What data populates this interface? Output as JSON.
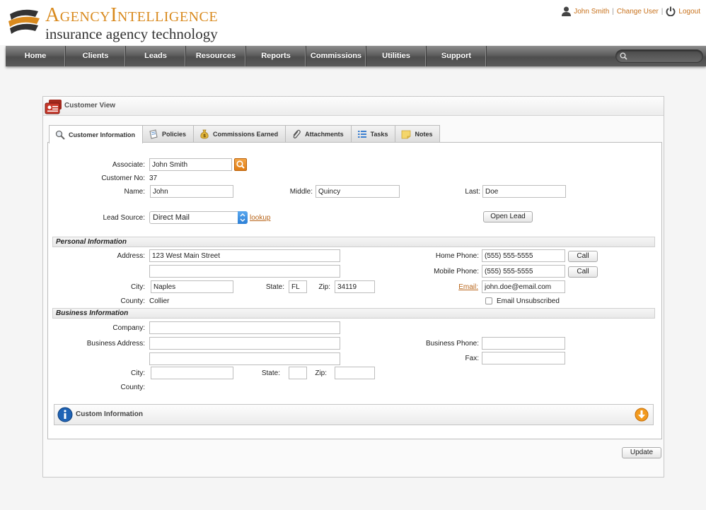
{
  "brand": {
    "title": "AgencyIntelligence",
    "subtitle": "insurance agency technology"
  },
  "userbar": {
    "user": "John Smith",
    "change_user": "Change User",
    "logout": "Logout",
    "separator": "|"
  },
  "nav": {
    "items": [
      "Home",
      "Clients",
      "Leads",
      "Resources",
      "Reports",
      "Commissions",
      "Utilities",
      "Support"
    ],
    "search_placeholder": ""
  },
  "panel": {
    "title": "Customer View",
    "tabs": [
      "Customer Information",
      "Policies",
      "Commissions Earned",
      "Attachments",
      "Tasks",
      "Notes"
    ]
  },
  "form": {
    "associate_label": "Associate:",
    "associate_value": "John Smith",
    "customer_no_label": "Customer No:",
    "customer_no_value": "37",
    "name_label": "Name:",
    "name_value": "John",
    "middle_label": "Middle:",
    "middle_value": "Quincy",
    "last_label": "Last:",
    "last_value": "Doe",
    "lead_source_label": "Lead Source:",
    "lead_source_value": "Direct Mail",
    "lookup_link": "lookup",
    "open_lead_button": "Open Lead"
  },
  "personal": {
    "section_title": "Personal Information",
    "address_label": "Address:",
    "address1": "123 West Main Street",
    "address2": "",
    "city_label": "City:",
    "city_value": "Naples",
    "state_label": "State:",
    "state_value": "FL",
    "zip_label": "Zip:",
    "zip_value": "34119",
    "county_label": "County:",
    "county_value": "Collier",
    "home_phone_label": "Home Phone:",
    "home_phone_value": "(555) 555-5555",
    "mobile_phone_label": "Mobile Phone:",
    "mobile_phone_value": "(555) 555-5555",
    "call_button": "Call",
    "email_label": "Email:",
    "email_value": "john.doe@email.com",
    "unsubscribed_label": "Email Unsubscribed"
  },
  "business": {
    "section_title": "Business Information",
    "company_label": "Company:",
    "company_value": "",
    "address_label": "Business Address:",
    "address1": "",
    "address2": "",
    "city_label": "City:",
    "city_value": "",
    "state_label": "State:",
    "state_value": "",
    "zip_label": "Zip:",
    "zip_value": "",
    "county_label": "County:",
    "phone_label": "Business Phone:",
    "phone_value": "",
    "fax_label": "Fax:",
    "fax_value": ""
  },
  "custom": {
    "title": "Custom Information"
  },
  "actions": {
    "update_button": "Update"
  },
  "colors": {
    "accent": "#d98a1e",
    "link": "#b8651a",
    "nav": "#5e5e5e"
  }
}
